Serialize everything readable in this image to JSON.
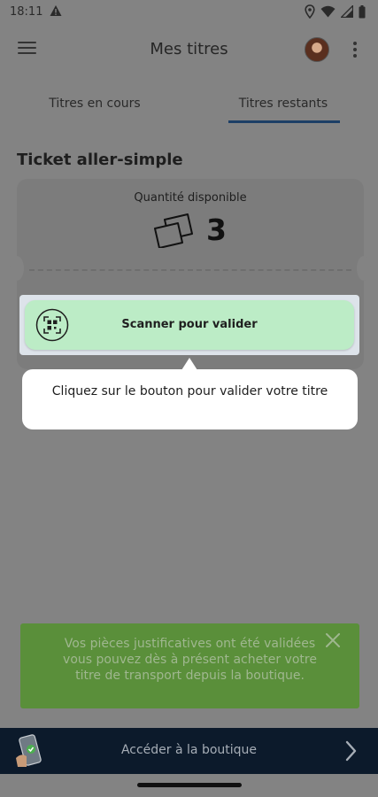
{
  "status_bar": {
    "time": "18:11"
  },
  "app_bar": {
    "title": "Mes titres"
  },
  "tabs": [
    {
      "label": "Titres en cours",
      "selected": false
    },
    {
      "label": "Titres restants",
      "selected": true
    }
  ],
  "ticket": {
    "title": "Ticket aller-simple",
    "quantity_label": "Quantité disponible",
    "quantity": "3",
    "scan_label": "Scanner pour valider"
  },
  "tooltip": {
    "text": "Cliquez sur le bouton pour valider votre titre"
  },
  "notice": {
    "text": "Vos pièces justificatives ont été validées vous pouvez dès à présent acheter votre titre de transport depuis la boutique."
  },
  "shop_bar": {
    "label": "Accéder à la boutique"
  },
  "colors": {
    "accent": "#1d3f66",
    "scan_button": "#bcecc6",
    "notice": "#5a8f3a",
    "shop_bar": "#0c1a2b"
  },
  "icons": [
    "alert-icon",
    "location-icon",
    "wifi-icon",
    "signal-icon",
    "battery-icon",
    "menu-icon",
    "avatar",
    "more-icon",
    "ticket-icon",
    "qr-scan-icon",
    "close-icon",
    "shop-phone-icon",
    "chevron-right-icon"
  ]
}
